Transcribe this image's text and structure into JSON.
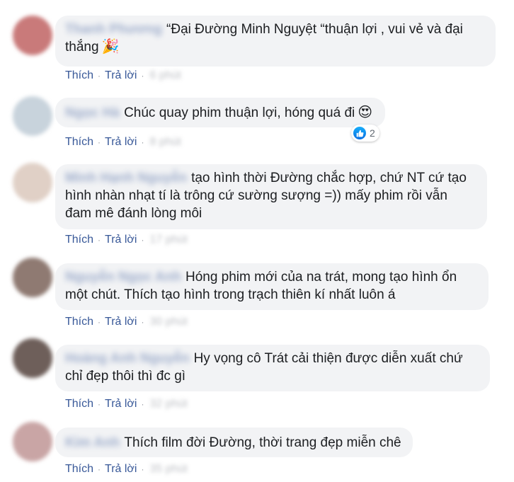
{
  "actions": {
    "like": "Thích",
    "reply": "Trả lời",
    "separator": "·"
  },
  "comments": [
    {
      "author": "Thanh Phương",
      "text": "“Đại Đường Minh Nguyệt “thuận lợi , vui vẻ và đại thắng",
      "emoji": "🎉",
      "time": "6 phút",
      "avatar_color": "#c97a7a"
    },
    {
      "author": "Ngọc Hà",
      "text": "Chúc quay phim thuận lợi, hóng quá đi",
      "emoji": "😍",
      "time": "8 phút",
      "reactions": "2",
      "avatar_color": "#c8d3dc"
    },
    {
      "author": "Minh Hạnh Nguyễn",
      "text": "tạo hình thời Đường chắc hợp, chứ NT cứ tạo hình nhàn nhạt tí là trông cứ sường sượng =)) mấy phim rồi vẫn đam mê đánh lòng môi",
      "time": "17 phút",
      "avatar_color": "#e0d0c6"
    },
    {
      "author": "Nguyễn Ngọc Anh",
      "text": "Hóng phim mới của na trát, mong tạo hình ổn một chút. Thích tạo hình trong trạch thiên kí nhất luôn á",
      "time": "30 phút",
      "avatar_color": "#8f7a72"
    },
    {
      "author": "Hoàng Anh Nguyễn",
      "text": "Hy vọng cô Trát cải thiện được diễn xuất chứ chỉ đẹp thôi thì đc gì",
      "time": "32 phút",
      "avatar_color": "#6e5f5a"
    },
    {
      "author": "Kim Anh",
      "text": "Thích film đời Đường, thời trang đẹp miễn chê",
      "time": "35 phút",
      "avatar_color": "#c9a5a5"
    }
  ]
}
